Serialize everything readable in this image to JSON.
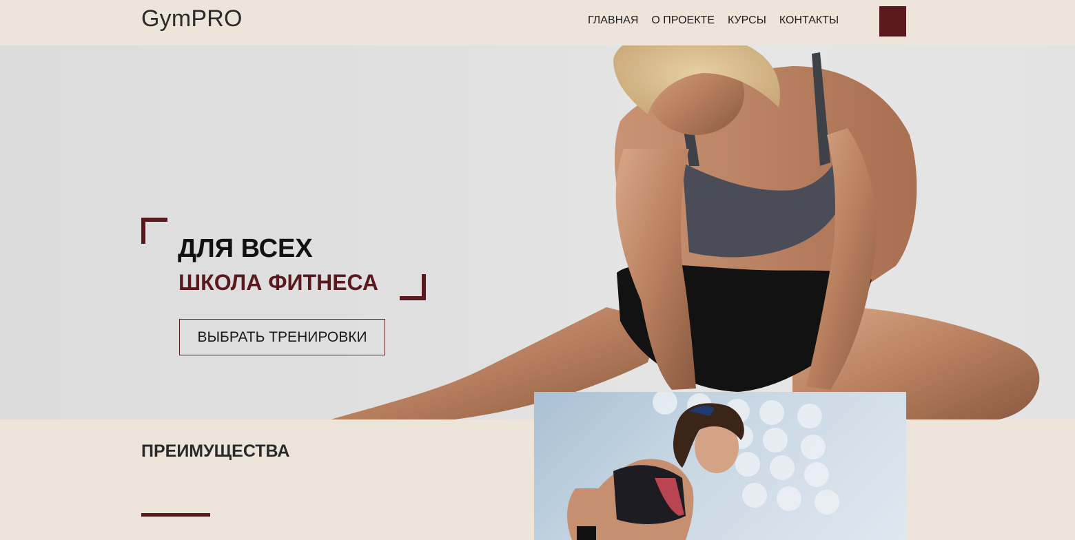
{
  "header": {
    "logo": "GymPRO",
    "nav": [
      "ГЛАВНАЯ",
      "О ПРОЕКТЕ",
      "КУРСЫ",
      "КОНТАКТЫ"
    ],
    "menu_icon": "menu-square-icon"
  },
  "hero": {
    "title": "ДЛЯ ВСЕХ",
    "subtitle": "ШКОЛА ФИТНЕСА",
    "button": "ВЫБРАТЬ ТРЕНИРОВКИ"
  },
  "advantages": {
    "title": "ПРЕИМУЩЕСТВА"
  },
  "colors": {
    "accent": "#5a1a1d",
    "background": "#ede4da",
    "hero_bg": "#e0e0e0"
  }
}
